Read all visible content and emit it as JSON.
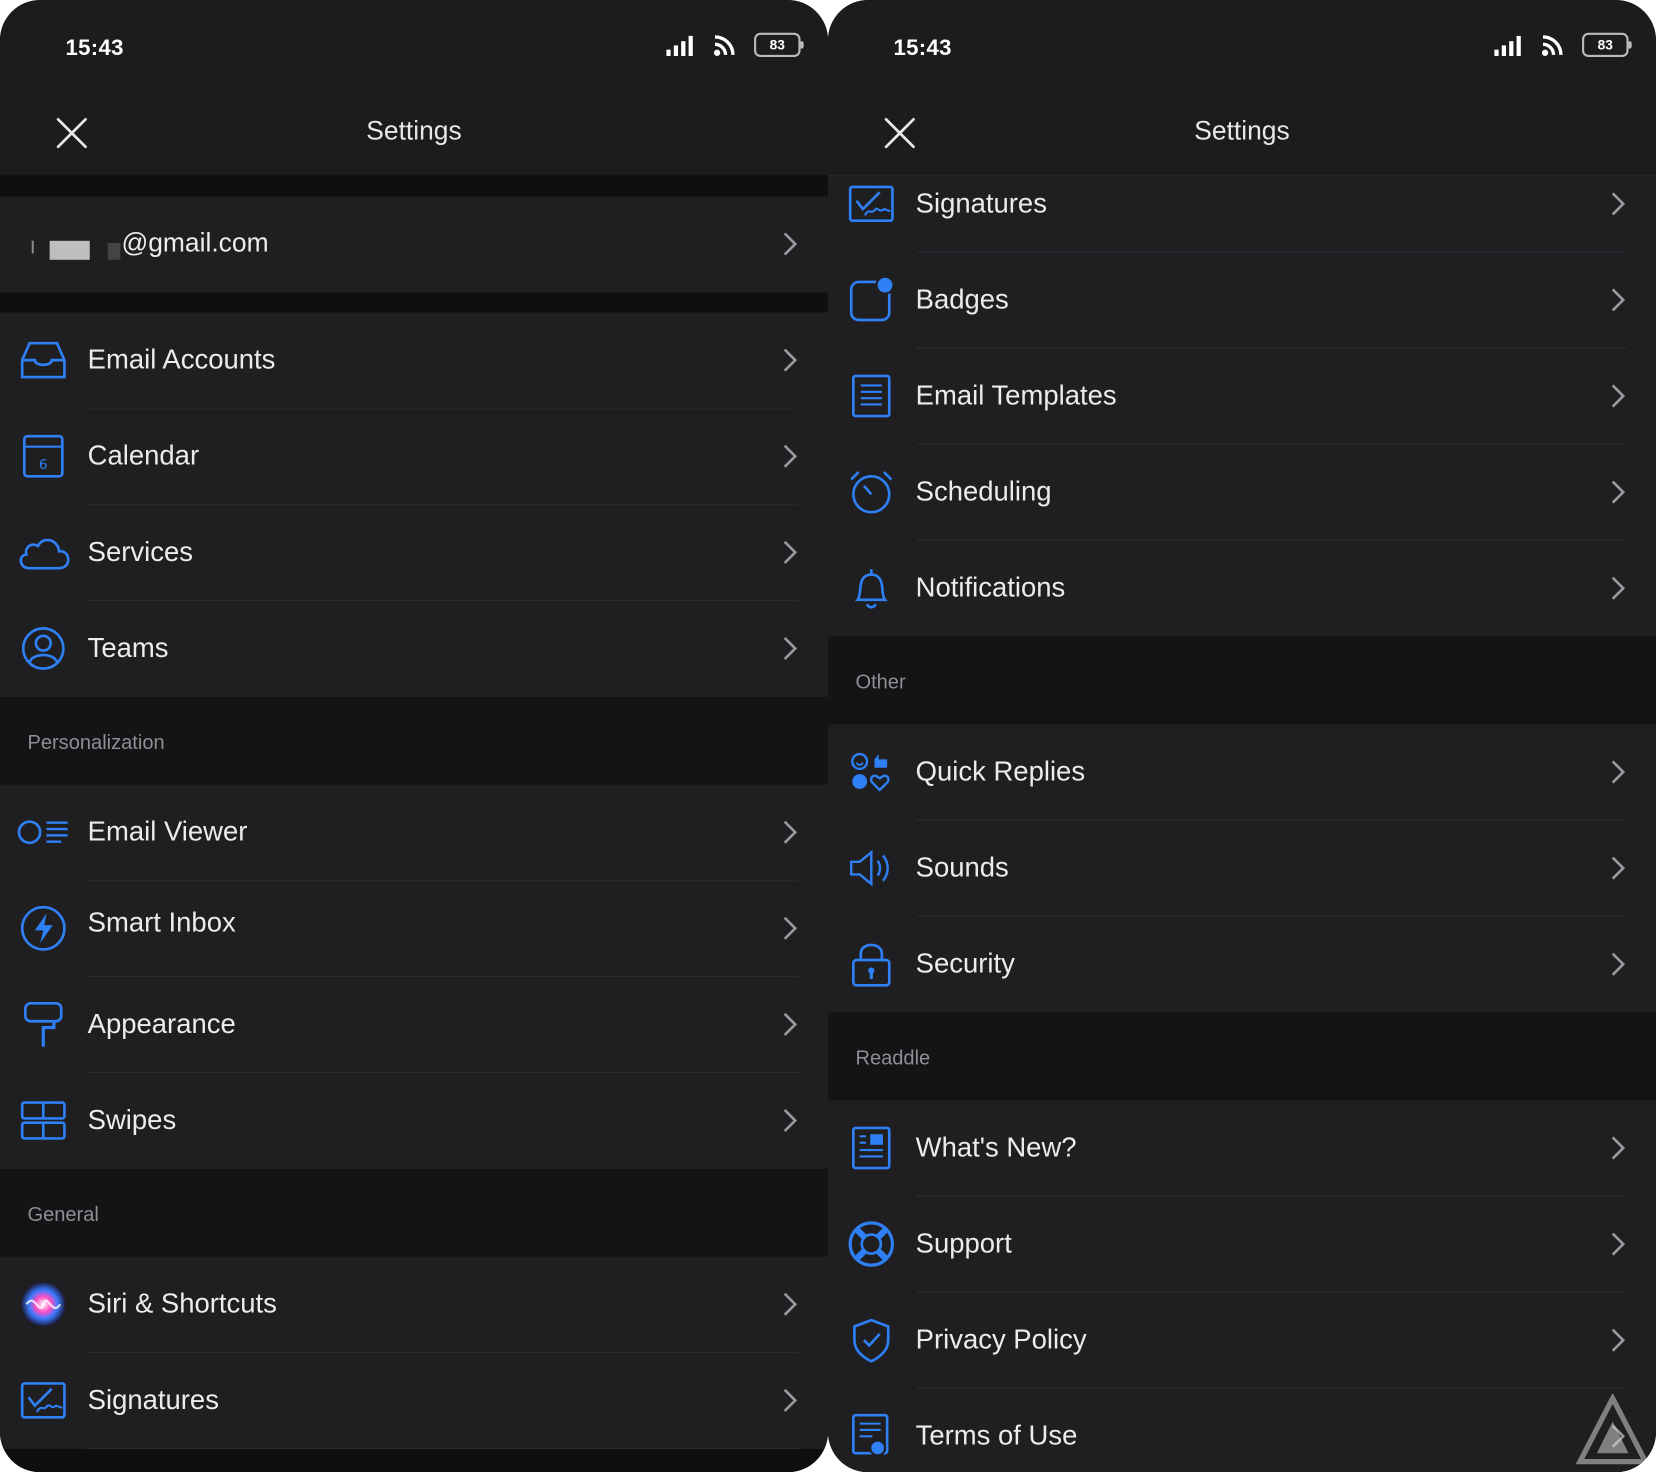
{
  "left_screen": {
    "status": {
      "time": "15:43",
      "battery": "83"
    },
    "nav": {
      "title": "Settings"
    },
    "account": {
      "email": "@gmail.com"
    },
    "groups": [
      {
        "items": [
          {
            "label": "Email Accounts",
            "icon": "inbox-tray-icon"
          },
          {
            "label": "Calendar",
            "icon": "calendar-icon"
          },
          {
            "label": "Services",
            "icon": "cloud-icon"
          },
          {
            "label": "Teams",
            "icon": "person-circle-icon"
          }
        ]
      },
      {
        "title": "Personalization",
        "items": [
          {
            "label": "Email Viewer",
            "icon": "email-viewer-icon"
          },
          {
            "label": "Smart Inbox",
            "icon": "lightning-circle-icon"
          },
          {
            "label": "Appearance",
            "icon": "paint-roller-icon"
          },
          {
            "label": "Swipes",
            "icon": "swipes-grid-icon"
          }
        ]
      },
      {
        "title": "General",
        "items": [
          {
            "label": "Siri & Shortcuts",
            "icon": "siri-icon"
          },
          {
            "label": "Signatures",
            "icon": "signature-icon"
          }
        ]
      }
    ]
  },
  "right_screen": {
    "status": {
      "time": "15:43",
      "battery": "83"
    },
    "nav": {
      "title": "Settings"
    },
    "groups": [
      {
        "items": [
          {
            "label": "Signatures",
            "icon": "signature-icon"
          },
          {
            "label": "Badges",
            "icon": "badge-icon"
          },
          {
            "label": "Email Templates",
            "icon": "document-lines-icon"
          },
          {
            "label": "Scheduling",
            "icon": "alarm-clock-icon"
          },
          {
            "label": "Notifications",
            "icon": "bell-icon"
          }
        ]
      },
      {
        "title": "Other",
        "items": [
          {
            "label": "Quick Replies",
            "icon": "quick-replies-icon"
          },
          {
            "label": "Sounds",
            "icon": "speaker-icon"
          },
          {
            "label": "Security",
            "icon": "padlock-icon"
          }
        ]
      },
      {
        "title": "Readdle",
        "items": [
          {
            "label": "What's New?",
            "icon": "news-icon"
          },
          {
            "label": "Support",
            "icon": "lifebuoy-icon"
          },
          {
            "label": "Privacy Policy",
            "icon": "shield-check-icon"
          },
          {
            "label": "Terms of Use",
            "icon": "certificate-icon"
          }
        ]
      }
    ]
  },
  "colors": {
    "accent": "#2f7ff5",
    "background": "#1f1f22",
    "section_background": "#141416"
  }
}
